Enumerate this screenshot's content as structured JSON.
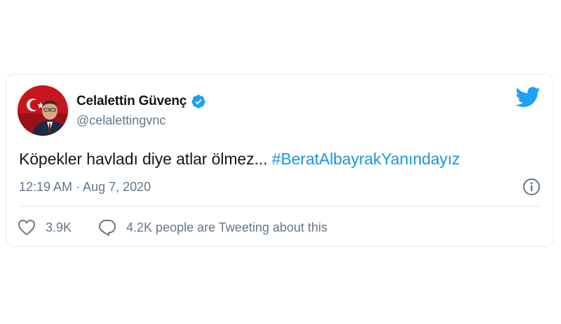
{
  "tweet": {
    "author": {
      "display_name": "Celalettin Güvenç",
      "handle": "@celalettingvnc",
      "verified": true
    },
    "text": "Köpekler havladı diye atlar ölmez...",
    "hashtag": "#BeratAlbayrakYanındayız",
    "timestamp": "12:19 AM · Aug 7, 2020",
    "likes": "3.9K",
    "conversation": "4.2K people are Tweeting about this"
  },
  "colors": {
    "twitter_blue": "#1da1f2",
    "link_blue": "#1b95e0",
    "muted_text": "#657786",
    "primary_text": "#14171a"
  },
  "icons": {
    "brand": "twitter-bird-icon",
    "verified": "verified-badge-icon",
    "info": "info-icon",
    "like": "heart-icon",
    "reply": "speech-bubble-icon"
  }
}
